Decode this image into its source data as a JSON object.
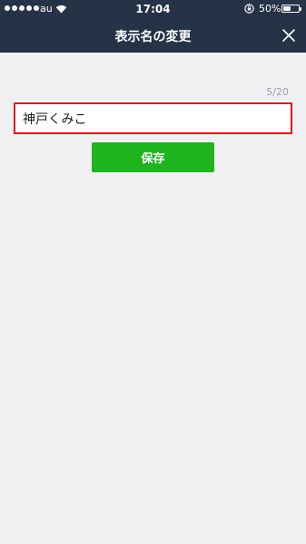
{
  "status_bar": {
    "carrier": "au",
    "time": "17:04",
    "battery_percent": "50%",
    "battery_level": 0.5,
    "icons": [
      "signal-dots-icon",
      "wifi-icon",
      "rotation-lock-icon",
      "battery-icon"
    ]
  },
  "nav": {
    "title": "表示名の変更",
    "close_icon": "close-icon"
  },
  "form": {
    "char_count": "5/20",
    "name_value": "神戸くみこ",
    "save_label": "保存"
  },
  "colors": {
    "header_bg": "#263246",
    "page_bg": "#f0f0f2",
    "input_border": "#e0161c",
    "save_button": "#1db41d"
  }
}
